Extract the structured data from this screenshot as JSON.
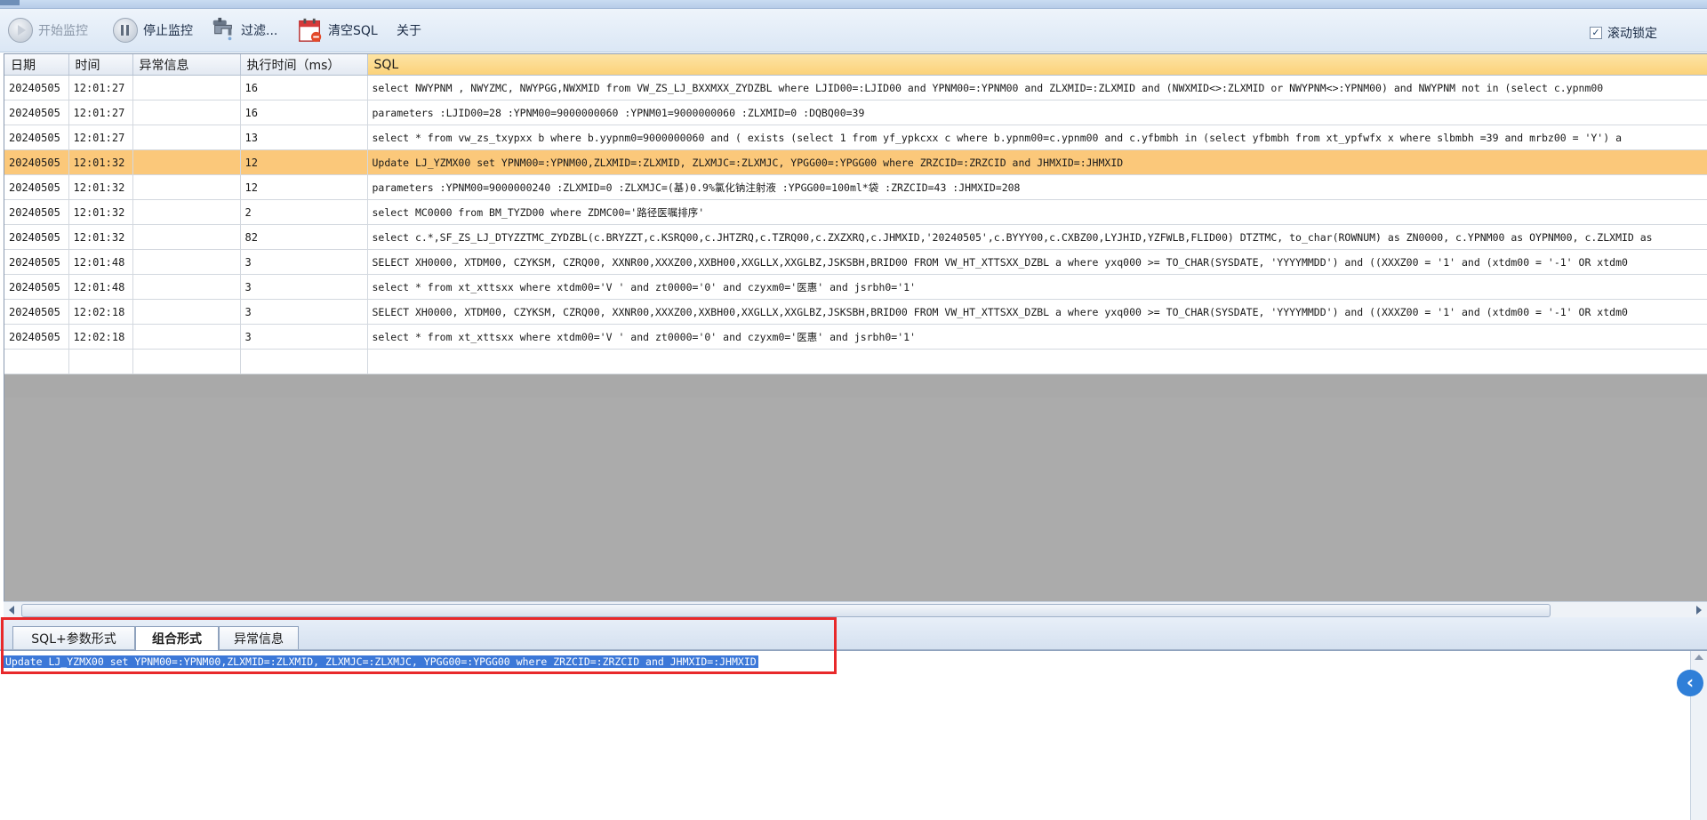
{
  "toolbar": {
    "start_label": "开始监控",
    "stop_label": "停止监控",
    "filter_label": "过滤...",
    "clear_label": "清空SQL",
    "about_label": "关于",
    "scroll_lock_label": "滚动锁定",
    "scroll_lock_checked": true
  },
  "grid": {
    "columns": [
      "日期",
      "时间",
      "异常信息",
      "执行时间（ms）",
      "SQL"
    ],
    "rows": [
      {
        "date": "20240505",
        "time": "12:01:27",
        "error": "",
        "ms": "16",
        "sql": "select NWYPNM ,   NWYZMC,   NWYPGG,NWXMID  from  VW_ZS_LJ_BXXMXX_ZYDZBL where  LJID00=:LJID00 and YPNM00=:YPNM00 and ZLXMID=:ZLXMID and (NWXMID<>:ZLXMID or NWYPNM<>:YPNM00) and NWYPNM not in (select c.ypnm00"
      },
      {
        "date": "20240505",
        "time": "12:01:27",
        "error": "",
        "ms": "16",
        "sql": "parameters :LJID00=28 :YPNM00=9000000060 :YPNM01=9000000060 :ZLXMID=0 :DQBQ00=39"
      },
      {
        "date": "20240505",
        "time": "12:01:27",
        "error": "",
        "ms": "13",
        "sql": "select *  from  vw_zs_txypxx  b where b.yypnm0=9000000060 and ( exists (select 1 from yf_ypkcxx c where b.ypnm00=c.ypnm00 and c.yfbmbh in (select yfbmbh from xt_ypfwfx x   where slbmbh =39  and mrbz00 = 'Y') a"
      },
      {
        "date": "20240505",
        "time": "12:01:32",
        "error": "",
        "ms": "12",
        "sql": "Update LJ_YZMX00 set YPNM00=:YPNM00,ZLXMID=:ZLXMID, ZLXMJC=:ZLXMJC, YPGG00=:YPGG00 where ZRZCID=:ZRZCID and JHMXID=:JHMXID",
        "selected": true
      },
      {
        "date": "20240505",
        "time": "12:01:32",
        "error": "",
        "ms": "12",
        "sql": "parameters :YPNM00=9000000240 :ZLXMID=0 :ZLXMJC=(基)0.9%氯化钠注射液 :YPGG00=100ml*袋 :ZRZCID=43 :JHMXID=208"
      },
      {
        "date": "20240505",
        "time": "12:01:32",
        "error": "",
        "ms": "2",
        "sql": "select MC0000 from BM_TYZD00 where ZDMC00='路径医嘱排序'"
      },
      {
        "date": "20240505",
        "time": "12:01:32",
        "error": "",
        "ms": "82",
        "sql": "select c.*,SF_ZS_LJ_DTYZZTMC_ZYDZBL(c.BRYZZT,c.KSRQ00,c.JHTZRQ,c.TZRQ00,c.ZXZXRQ,c.JHMXID,'20240505',c.BYYY00,c.CXBZ00,LYJHID,YZFWLB,FLID00) DTZTMC,  to_char(ROWNUM) as ZN0000,  c.YPNM00 as OYPNM00,  c.ZLXMID as"
      },
      {
        "date": "20240505",
        "time": "12:01:48",
        "error": "",
        "ms": "3",
        "sql": "SELECT XH0000,  XTDM00,  CZYKSM,  CZRQ00,  XXNR00,XXXZ00,XXBH00,XXGLLX,XXGLBZ,JSKSBH,BRID00   FROM VW_HT_XTTSXX_DZBL a where yxq000 >= TO_CHAR(SYSDATE, 'YYYYMMDD')   and ((XXXZ00 = '1'  and (xtdm00 = '-1' OR xtdm0"
      },
      {
        "date": "20240505",
        "time": "12:01:48",
        "error": "",
        "ms": "3",
        "sql": "select * from xt_xttsxx where xtdm00='V '   and zt0000='0'  and czyxm0='医惠'  and  jsrbh0='1'"
      },
      {
        "date": "20240505",
        "time": "12:02:18",
        "error": "",
        "ms": "3",
        "sql": "SELECT XH0000,  XTDM00,  CZYKSM,  CZRQ00,  XXNR00,XXXZ00,XXBH00,XXGLLX,XXGLBZ,JSKSBH,BRID00   FROM VW_HT_XTTSXX_DZBL a where yxq000 >= TO_CHAR(SYSDATE, 'YYYYMMDD')   and ((XXXZ00 = '1'  and (xtdm00 = '-1' OR xtdm0"
      },
      {
        "date": "20240505",
        "time": "12:02:18",
        "error": "",
        "ms": "3",
        "sql": "select * from xt_xttsxx where xtdm00='V '   and zt0000='0'  and czyxm0='医惠'  and  jsrbh0='1'"
      }
    ]
  },
  "tabs": [
    {
      "label": "SQL+参数形式",
      "active": false
    },
    {
      "label": "组合形式",
      "active": true
    },
    {
      "label": "异常信息",
      "active": false
    }
  ],
  "detail": {
    "text": "Update LJ_YZMX00 set YPNM00=:YPNM00,ZLXMID=:ZLXMID, ZLXMJC=:ZLXMJC, YPGG00=:YPGG00 where ZRZCID=:ZRZCID and JHMXID=:JHMXID"
  },
  "sidebar_button": {
    "label": "‹"
  },
  "colors": {
    "selected_row": "#fbc87a",
    "highlight_box": "#e8292b",
    "text_selection": "#3c78d8",
    "sql_header": "#fbd27a"
  },
  "icons": [
    "play-icon",
    "pause-icon",
    "filter-faucet-icon",
    "calendar-clear-icon",
    "checkbox-icon",
    "scroll-left-arrow-icon",
    "scroll-right-arrow-icon",
    "scroll-up-arrow-icon",
    "collapse-chevron-icon"
  ]
}
